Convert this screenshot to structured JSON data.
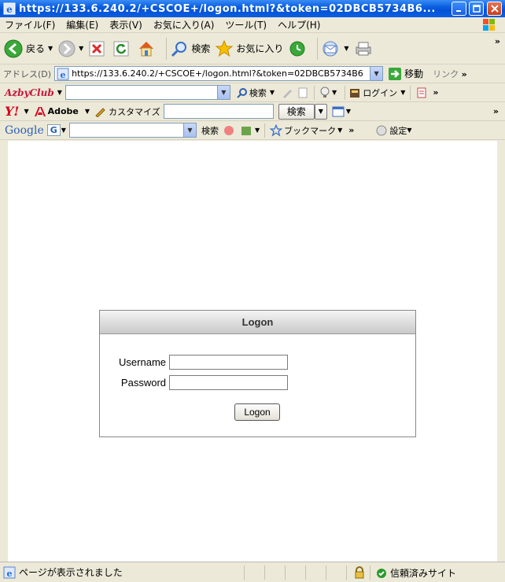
{
  "window": {
    "title": "https://133.6.240.2/+CSCOE+/logon.html?&token=02DBCB5734B6..."
  },
  "menu": [
    "ファイル(F)",
    "編集(E)",
    "表示(V)",
    "お気に入り(A)",
    "ツール(T)",
    "ヘルプ(H)"
  ],
  "toolbar": {
    "back": "戻る",
    "search": "検索",
    "favorites": "お気に入り"
  },
  "address": {
    "label": "アドレス(D)",
    "url": "https://133.6.240.2/+CSCOE+/logon.html?&token=02DBCB5734B6",
    "go": "移動",
    "links": "リンク"
  },
  "azby": {
    "brand": "AzbyClub",
    "search": "検索",
    "login": "ログイン"
  },
  "yahoo": {
    "brand": "Y!",
    "adobe": "Adobe",
    "customize": "カスタマイズ",
    "search_button": "検索"
  },
  "google": {
    "brand": "Google",
    "search": "検索",
    "bookmarks": "ブックマーク",
    "settings": "設定"
  },
  "logon": {
    "header": "Logon",
    "username_label": "Username",
    "password_label": "Password",
    "username_value": "",
    "password_value": "",
    "button": "Logon"
  },
  "status": {
    "text": "ページが表示されました",
    "zone": "信頼済みサイト"
  }
}
